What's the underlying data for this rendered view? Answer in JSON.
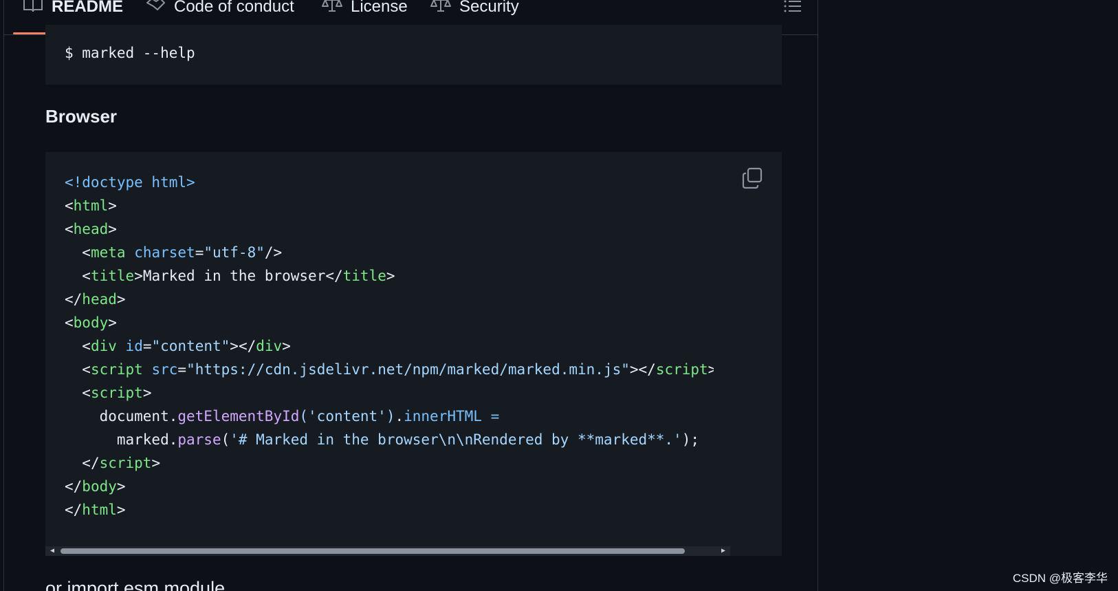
{
  "tabs": [
    {
      "label": "README",
      "icon": "book-icon",
      "active": true
    },
    {
      "label": "Code of conduct",
      "icon": "handshake-icon",
      "active": false
    },
    {
      "label": "License",
      "icon": "law-icon",
      "active": false
    },
    {
      "label": "Security",
      "icon": "law-icon",
      "active": false
    }
  ],
  "top_code": {
    "line": "$ marked --help"
  },
  "browser_heading": "Browser",
  "code_tokens": {
    "l1": "<!doctype html>",
    "lt": "<",
    "gt": ">",
    "lt_slash": "</",
    "self_close": "/>",
    "eq": "=",
    "html": "html",
    "head": "head",
    "meta": "meta",
    "charset": "charset",
    "utf8": "\"utf-8\"",
    "title": "title",
    "title_text": "Marked in the browser",
    "body": "body",
    "div": "div",
    "id": "id",
    "content": "\"content\"",
    "script": "script",
    "src": "src",
    "src_val": "\"https://cdn.jsdelivr.net/npm/marked/marked.min.js\"",
    "document": "document.",
    "getById": "getElementById",
    "arg": "('content')",
    "dot": ".",
    "innerHTML": "innerHTML",
    "assign": " =",
    "marked": "marked.",
    "parse": "parse",
    "open_paren": "(",
    "parse_arg": "'# Marked in the browser\\n\\nRendered by **marked**.'",
    "close_end": ");"
  },
  "bottom_text": "or import esm module",
  "watermark": "CSDN @极客李华",
  "colors": {
    "background": "#0d1117",
    "code_bg": "#161b22",
    "active_tab_underline": "#f78166",
    "tag": "#7ee787",
    "attribute": "#79c0ff",
    "string": "#a5d6ff",
    "function": "#d2a8ff"
  }
}
